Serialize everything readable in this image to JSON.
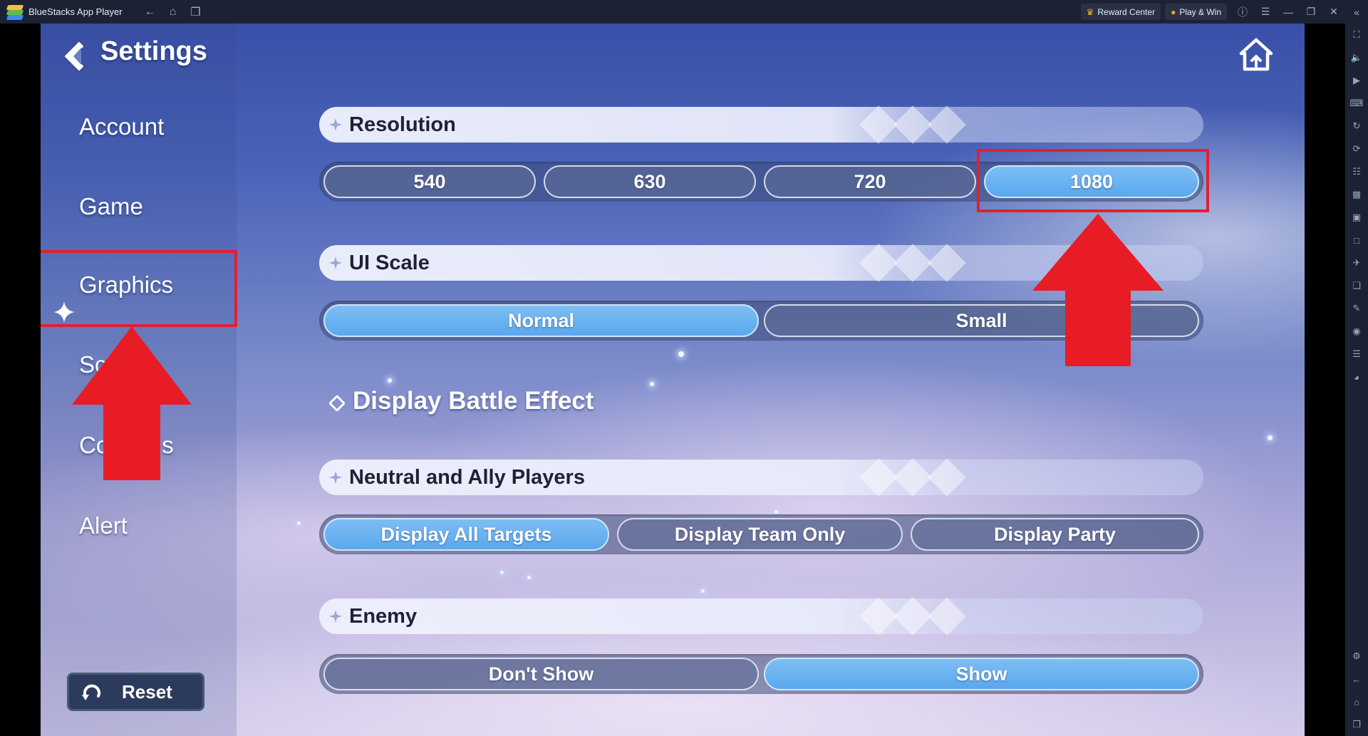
{
  "window": {
    "title": "BlueStacks App Player",
    "reward_center": "Reward Center",
    "play_win": "Play & Win"
  },
  "page": {
    "title": "Settings"
  },
  "menu": {
    "account": "Account",
    "game": "Game",
    "graphics": "Graphics",
    "sound_partial": "Sc",
    "controls_partial_a": "Co",
    "controls_partial_b": "s",
    "alert": "Alert",
    "reset": "Reset"
  },
  "resolution": {
    "label": "Resolution",
    "options": [
      "540",
      "630",
      "720",
      "1080"
    ],
    "selected": "1080"
  },
  "ui_scale": {
    "label": "UI Scale",
    "options": [
      "Normal",
      "Small"
    ],
    "selected": "Normal"
  },
  "display_battle_effect": {
    "title": "Display Battle Effect",
    "neutral_ally": {
      "label": "Neutral and Ally Players",
      "options": [
        "Display All Targets",
        "Display Team Only",
        "Display Party"
      ],
      "selected": "Display All Targets"
    },
    "enemy": {
      "label": "Enemy",
      "options": [
        "Don't Show",
        "Show"
      ],
      "selected": "Show"
    }
  },
  "colors": {
    "active_option": "#5aa8ee",
    "annotation_red": "#e02030",
    "titlebar": "#1c2234"
  },
  "icons": {
    "back": "back-chevron-icon",
    "home": "home-icon",
    "reset": "reset-icon",
    "selected_menu": "sparkle-star-icon"
  }
}
